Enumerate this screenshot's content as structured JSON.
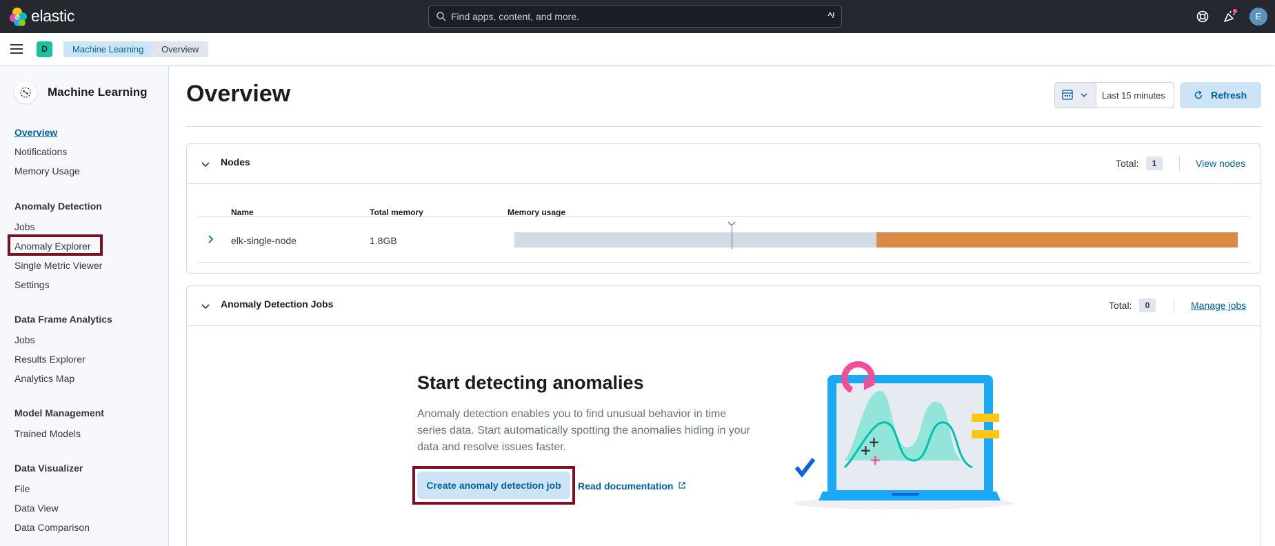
{
  "header": {
    "logo_text": "elastic",
    "search_placeholder": "Find apps, content, and more.",
    "search_shortcut": "^/",
    "avatar_initial": "E"
  },
  "subbar": {
    "space_initial": "D",
    "breadcrumbs": [
      "Machine Learning",
      "Overview"
    ]
  },
  "sidebar": {
    "title": "Machine Learning",
    "top_links": [
      "Overview",
      "Notifications",
      "Memory Usage"
    ],
    "groups": [
      {
        "label": "Anomaly Detection",
        "items": [
          "Jobs",
          "Anomaly Explorer",
          "Single Metric Viewer",
          "Settings"
        ]
      },
      {
        "label": "Data Frame Analytics",
        "items": [
          "Jobs",
          "Results Explorer",
          "Analytics Map"
        ]
      },
      {
        "label": "Model Management",
        "items": [
          "Trained Models"
        ]
      },
      {
        "label": "Data Visualizer",
        "items": [
          "File",
          "Data View",
          "Data Comparison"
        ]
      }
    ]
  },
  "main": {
    "title": "Overview",
    "date_range": "Last 15 minutes",
    "refresh_label": "Refresh",
    "nodes": {
      "title": "Nodes",
      "total_label": "Total:",
      "total_value": "1",
      "view_link": "View nodes",
      "columns": [
        "Name",
        "Total memory",
        "Memory usage"
      ],
      "rows": [
        {
          "name": "elk-single-node",
          "total_memory": "1.8GB",
          "memory_used_fraction": 0.5
        }
      ]
    },
    "jobs": {
      "title": "Anomaly Detection Jobs",
      "total_label": "Total:",
      "total_value": "0",
      "manage_link": "Manage jobs",
      "empty_title": "Start detecting anomalies",
      "empty_body": "Anomaly detection enables you to find unusual behavior in time series data. Start automatically spotting the anomalies hiding in your data and resolve issues faster.",
      "create_button": "Create anomaly detection job",
      "read_doc_link": "Read documentation"
    }
  },
  "colors": {
    "accent": "#0061a6",
    "memory_fill": "#da8b45",
    "highlight": "#7f1021"
  }
}
